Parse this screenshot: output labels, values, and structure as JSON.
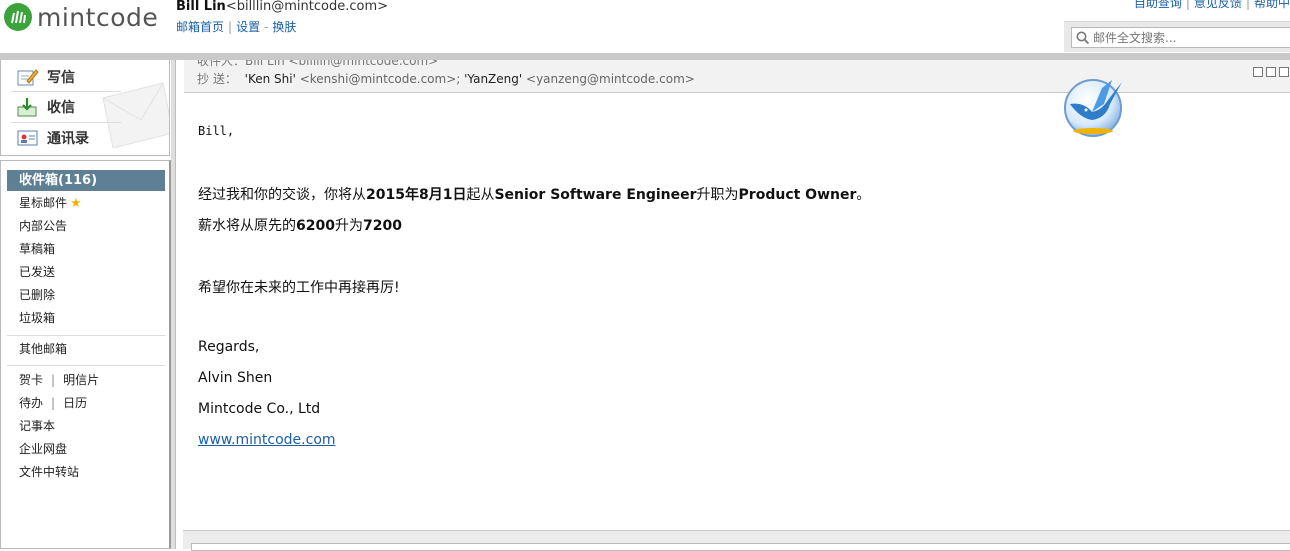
{
  "brand": {
    "logo_text": "mintcode",
    "logo_color": "#3aa43a"
  },
  "header": {
    "user_name": "Bill Lin",
    "user_email": "<billlin@mintcode.com>",
    "links": [
      "邮箱首页",
      "设置",
      "换肤"
    ],
    "top_right_links": [
      "自助查询",
      "意见反馈",
      "帮助中"
    ],
    "search_placeholder": "邮件全文搜索..."
  },
  "actions": [
    {
      "label": "写信",
      "icon": "compose-icon"
    },
    {
      "label": "收信",
      "icon": "inbox-download-icon"
    },
    {
      "label": "通讯录",
      "icon": "contacts-icon"
    }
  ],
  "folders": {
    "inbox": "收件箱(116)",
    "starred": "星标邮件",
    "announcements": "内部公告",
    "drafts": "草稿箱",
    "sent": "已发送",
    "deleted": "已删除",
    "spam": "垃圾箱",
    "other": "其他邮箱",
    "cards": "贺卡",
    "postcards": "明信片",
    "todo": "待办",
    "calendar": "日历",
    "notes": "记事本",
    "netdisk": "企业网盘",
    "transfer": "文件中转站"
  },
  "mail": {
    "to_line": "收件人：Bill Lin <billlin@mintcode.com>",
    "cc_label": "抄  送：",
    "cc": [
      {
        "name": "'Ken Shi'",
        "addr": "<kenshi@mintcode.com>;"
      },
      {
        "name": "'YanZeng'",
        "addr": "<yanzeng@mintcode.com>"
      }
    ],
    "greeting": "Bill,",
    "p1_a": "经过我和你的交谈，你将从",
    "p1_date": "2015年8月1日",
    "p1_b": "起从",
    "p1_role_old": "Senior Software Engineer",
    "p1_c": "升职为",
    "p1_role_new": "Product Owner",
    "p1_d": "。",
    "p2_a": "薪水将从原先的",
    "p2_old": "6200",
    "p2_b": "升为",
    "p2_new": "7200",
    "p3": "希望你在未来的工作中再接再厉!",
    "regards": "Regards,",
    "signer": "Alvin Shen",
    "company": "Mintcode Co., Ltd",
    "website": "www.mintcode.com"
  },
  "colors": {
    "active_folder_bg": "#5f7f95",
    "link": "#1a5fa8",
    "accent_star": "#f5b400"
  }
}
